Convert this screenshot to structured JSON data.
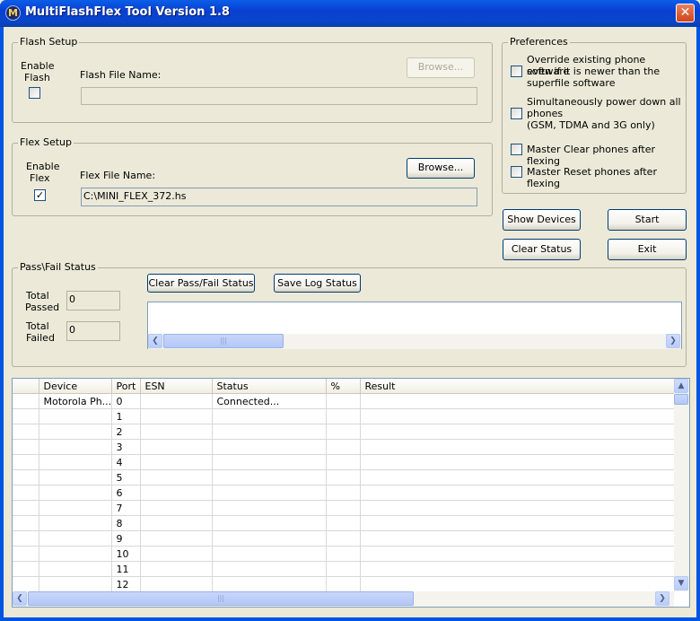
{
  "window": {
    "title": "MultiFlashFlex Tool Version 1.8",
    "close_glyph": "✕"
  },
  "flash_setup": {
    "legend": "Flash Setup",
    "enable_label_1": "Enable",
    "enable_label_2": "Flash",
    "enabled": false,
    "file_label": "Flash File Name:",
    "file_value": "",
    "browse_label": "Browse..."
  },
  "flex_setup": {
    "legend": "Flex Setup",
    "enable_label_1": "Enable",
    "enable_label_2": "Flex",
    "enabled": true,
    "file_label": "Flex File Name:",
    "file_value": "C:\\MINI_FLEX_372.hs",
    "browse_label": "Browse..."
  },
  "preferences": {
    "legend": "Preferences",
    "items": [
      {
        "lines": [
          "Override existing phone software",
          "even if it is newer than the",
          "superfile software"
        ],
        "checked": false
      },
      {
        "lines": [
          "Simultaneously power down all",
          "phones",
          "(GSM, TDMA and 3G only)"
        ],
        "checked": false
      },
      {
        "lines": [
          "Master Clear phones after flexing"
        ],
        "checked": false
      },
      {
        "lines": [
          "Master Reset phones after flexing"
        ],
        "checked": false
      }
    ]
  },
  "actions": {
    "show_devices": "Show Devices",
    "start": "Start",
    "clear_status": "Clear Status",
    "exit": "Exit"
  },
  "pass_fail": {
    "legend": "Pass\\Fail Status",
    "total_passed_1": "Total",
    "total_passed_2": "Passed",
    "total_passed_value": "0",
    "total_failed_1": "Total",
    "total_failed_2": "Failed",
    "total_failed_value": "0",
    "clear_button": "Clear Pass/Fail Status",
    "save_button": "Save Log Status"
  },
  "scroll_glyphs": {
    "left": "❮",
    "right": "❯",
    "up": "▲",
    "down": "▼",
    "grip": "|||"
  },
  "device_table": {
    "columns": [
      "",
      "Device",
      "Port",
      "ESN",
      "Status",
      "%",
      "Result"
    ],
    "rows": [
      [
        "",
        "Motorola Ph...",
        "0",
        "",
        "Connected...",
        "",
        ""
      ],
      [
        "",
        "",
        "1",
        "",
        "",
        "",
        ""
      ],
      [
        "",
        "",
        "2",
        "",
        "",
        "",
        ""
      ],
      [
        "",
        "",
        "3",
        "",
        "",
        "",
        ""
      ],
      [
        "",
        "",
        "4",
        "",
        "",
        "",
        ""
      ],
      [
        "",
        "",
        "5",
        "",
        "",
        "",
        ""
      ],
      [
        "",
        "",
        "6",
        "",
        "",
        "",
        ""
      ],
      [
        "",
        "",
        "7",
        "",
        "",
        "",
        ""
      ],
      [
        "",
        "",
        "8",
        "",
        "",
        "",
        ""
      ],
      [
        "",
        "",
        "9",
        "",
        "",
        "",
        ""
      ],
      [
        "",
        "",
        "10",
        "",
        "",
        "",
        ""
      ],
      [
        "",
        "",
        "11",
        "",
        "",
        "",
        ""
      ],
      [
        "",
        "",
        "12",
        "",
        "",
        "",
        ""
      ]
    ]
  }
}
